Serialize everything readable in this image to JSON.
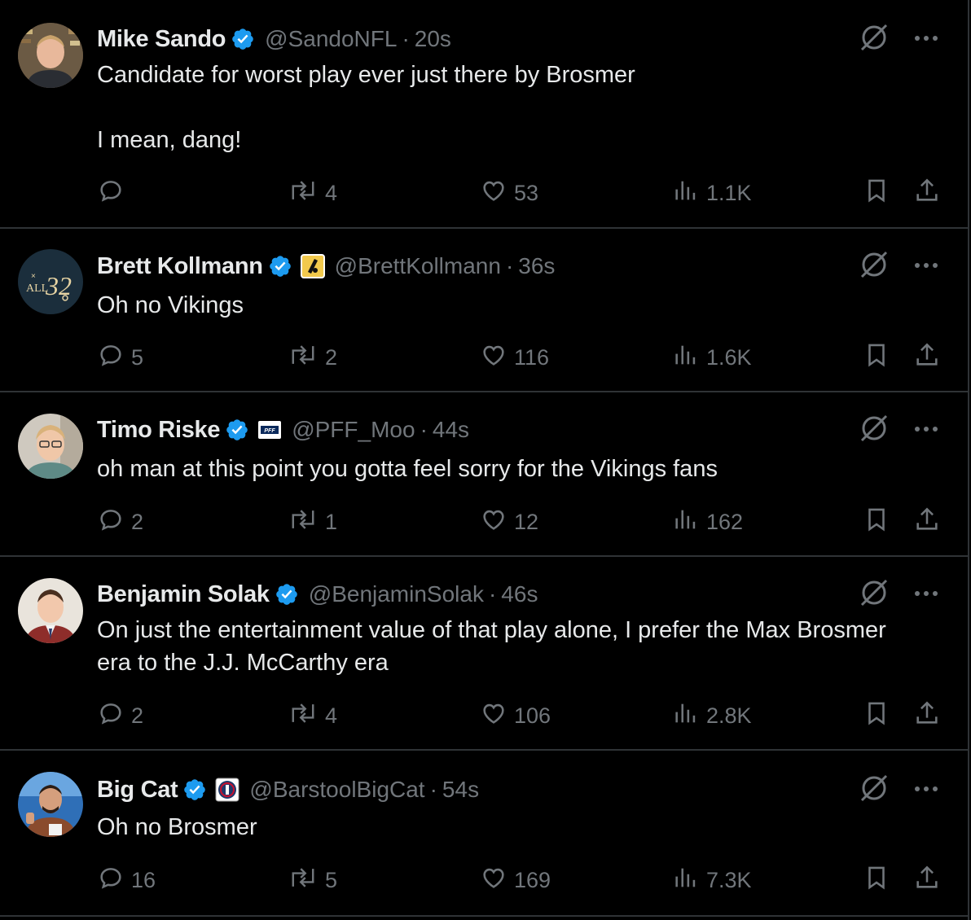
{
  "tweets": [
    {
      "name": "Mike Sando",
      "handle": "@SandoNFL",
      "time": "20s",
      "affiliation": null,
      "text_lines": [
        "Candidate for worst play ever just there by Brosmer",
        "",
        "I mean, dang!"
      ],
      "replies": "",
      "reposts": "4",
      "likes": "53",
      "views": "1.1K"
    },
    {
      "name": "Brett Kollmann",
      "handle": "@BrettKollmann",
      "time": "36s",
      "affiliation": "gold-badge",
      "avatar_text": "ALL32",
      "text_lines": [
        "Oh no Vikings"
      ],
      "replies": "5",
      "reposts": "2",
      "likes": "116",
      "views": "1.6K"
    },
    {
      "name": "Timo Riske",
      "handle": "@PFF_Moo",
      "time": "44s",
      "affiliation": "pff-badge",
      "text_lines": [
        "oh man at this point you gotta feel sorry for the Vikings fans"
      ],
      "replies": "2",
      "reposts": "1",
      "likes": "12",
      "views": "162"
    },
    {
      "name": "Benjamin Solak",
      "handle": "@BenjaminSolak",
      "time": "46s",
      "affiliation": null,
      "text_lines": [
        "On just the entertainment value of that play alone, I prefer the Max Brosmer",
        "era to the J.J. McCarthy era"
      ],
      "replies": "2",
      "reposts": "4",
      "likes": "106",
      "views": "2.8K"
    },
    {
      "name": "Big Cat",
      "handle": "@BarstoolBigCat",
      "time": "54s",
      "affiliation": "barstool-badge",
      "text_lines": [
        "Oh no Brosmer"
      ],
      "replies": "16",
      "reposts": "5",
      "likes": "169",
      "views": "7.3K"
    }
  ],
  "separator": "·",
  "colors": {
    "background": "#000000",
    "text": "#e7e9ea",
    "muted": "#71767b",
    "border": "#2f3336",
    "verified": "#1d9bf0"
  },
  "icons": [
    "grok-icon",
    "more-icon",
    "reply-icon",
    "repost-icon",
    "like-icon",
    "views-icon",
    "bookmark-icon",
    "share-icon",
    "verified-badge-icon"
  ]
}
